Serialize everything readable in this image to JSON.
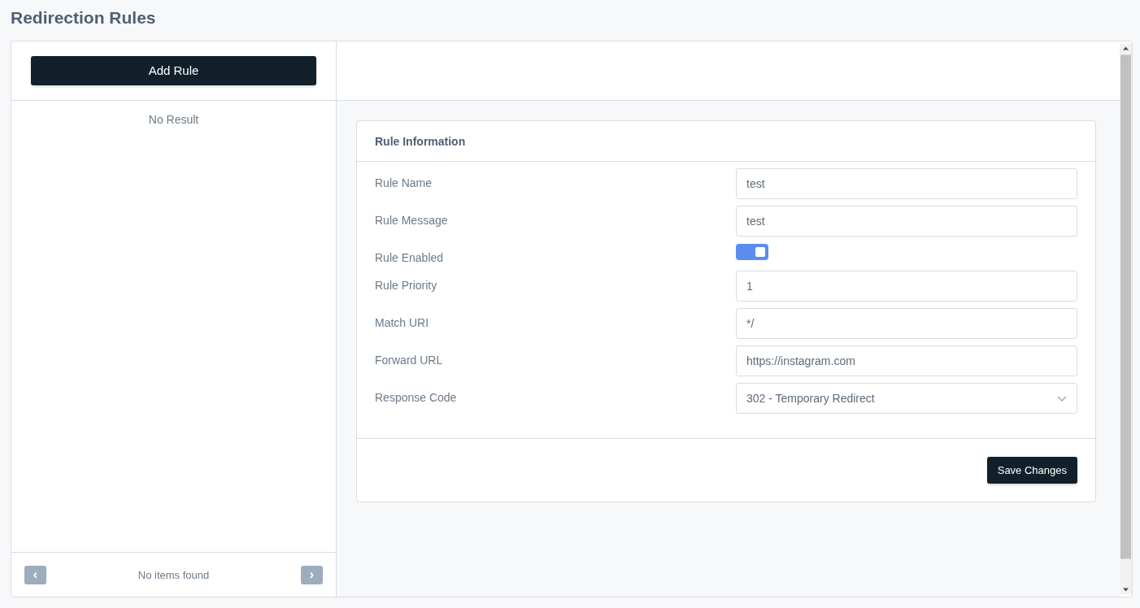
{
  "page": {
    "title": "Redirection Rules"
  },
  "sidebar": {
    "add_button": "Add Rule",
    "empty_text": "No Result",
    "pager": {
      "status": "No items found",
      "prev": {
        "label": "‹",
        "disabled": true
      },
      "next": {
        "label": "›",
        "disabled": true
      }
    }
  },
  "card": {
    "title": "Rule Information",
    "fields": [
      {
        "kind": "text",
        "label": "Rule Name",
        "value": "test"
      },
      {
        "kind": "text",
        "label": "Rule Message",
        "value": "test"
      },
      {
        "kind": "toggle",
        "label": "Rule Enabled",
        "on": true
      },
      {
        "kind": "text",
        "label": "Rule Priority",
        "value": "1"
      },
      {
        "kind": "text",
        "label": "Match URI",
        "value": "*/"
      },
      {
        "kind": "text",
        "label": "Forward URL",
        "value": "https://instagram.com"
      },
      {
        "kind": "select",
        "label": "Response Code",
        "value": "302 - Temporary Redirect"
      }
    ],
    "save_button": "Save Changes"
  }
}
